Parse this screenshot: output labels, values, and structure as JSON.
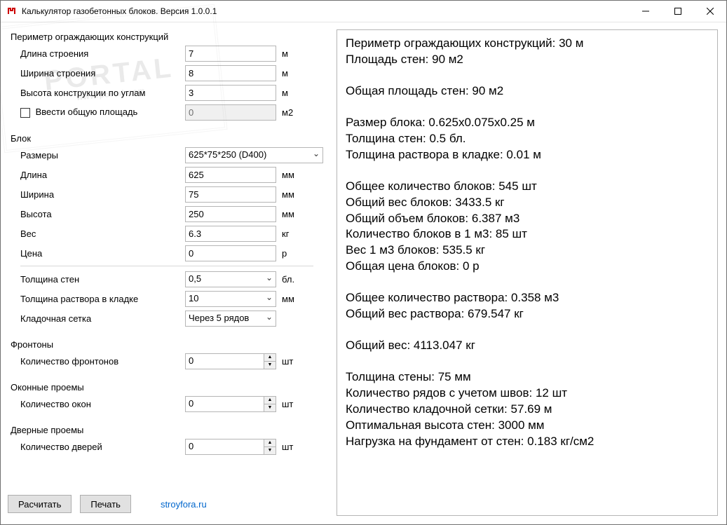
{
  "window": {
    "title": "Калькулятор газобетонных блоков. Версия 1.0.0.1"
  },
  "perimeter": {
    "title": "Периметр ограждающих конструкций",
    "length_label": "Длина строения",
    "length_value": "7",
    "width_label": "Ширина строения",
    "width_value": "8",
    "height_label": "Высота конструкции по углам",
    "height_value": "3",
    "area_check_label": "Ввести общую площадь",
    "area_value": "0",
    "unit_m": "м",
    "unit_m2": "м2"
  },
  "block": {
    "title": "Блок",
    "size_label": "Размеры",
    "size_value": "625*75*250 (D400)",
    "length_label": "Длина",
    "length_value": "625",
    "width_label": "Ширина",
    "width_value": "75",
    "height_label": "Высота",
    "height_value": "250",
    "weight_label": "Вес",
    "weight_value": "6.3",
    "price_label": "Цена",
    "price_value": "0",
    "wall_thickness_label": "Толщина стен",
    "wall_thickness_value": "0,5",
    "mortar_thickness_label": "Толщина раствора в кладке",
    "mortar_thickness_value": "10",
    "mesh_label": "Кладочная сетка",
    "mesh_value": "Через 5 рядов",
    "unit_mm": "мм",
    "unit_kg": "кг",
    "unit_p": "р",
    "unit_bl": "бл."
  },
  "gables": {
    "title": "Фронтоны",
    "count_label": "Количество фронтонов",
    "count_value": "0",
    "unit_sht": "шт"
  },
  "windows": {
    "title": "Оконные проемы",
    "count_label": "Количество окон",
    "count_value": "0",
    "unit_sht": "шт"
  },
  "doors": {
    "title": "Дверные проемы",
    "count_label": "Количество дверей",
    "count_value": "0",
    "unit_sht": "шт"
  },
  "footer": {
    "calc": "Расчитать",
    "print": "Печать",
    "link": "stroyfora.ru"
  },
  "results": {
    "l1": "Периметр ограждающих конструкций: 30 м",
    "l2": "Площадь стен: 90 м2",
    "l3": "Общая площадь стен: 90 м2",
    "l4": "Размер блока: 0.625x0.075x0.25 м",
    "l5": "Толщина стен: 0.5 бл.",
    "l6": "Толщина раствора в кладке: 0.01 м",
    "l7": "Общее количество блоков: 545 шт",
    "l8": "Общий вес блоков: 3433.5 кг",
    "l9": "Общий объем блоков: 6.387 м3",
    "l10": "Количество блоков в 1 м3: 85 шт",
    "l11": "Вес 1 м3 блоков: 535.5 кг",
    "l12": "Общая цена блоков: 0 р",
    "l13": "Общее количество раствора: 0.358 м3",
    "l14": "Общий вес раствора: 679.547 кг",
    "l15": "Общий вес: 4113.047 кг",
    "l16": "Толщина стены: 75 мм",
    "l17": "Количество рядов с учетом швов: 12 шт",
    "l18": "Количество кладочной сетки: 57.69 м",
    "l19": "Оптимальная высота стен: 3000 мм",
    "l20": "Нагрузка на фундамент от стен: 0.183 кг/см2"
  }
}
